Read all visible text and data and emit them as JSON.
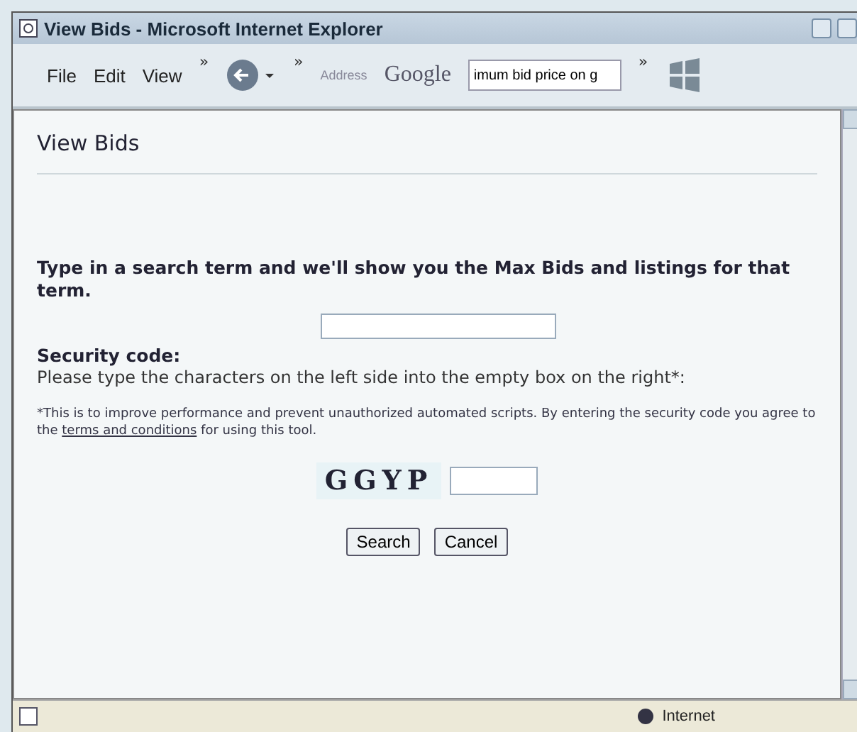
{
  "window": {
    "title": "View Bids - Microsoft Internet Explorer"
  },
  "menu": [
    "File",
    "Edit",
    "View"
  ],
  "toolbar": {
    "chevron": "»",
    "address_label": "Address",
    "search_brand": "Google",
    "search_value": "imum bid price on g"
  },
  "page": {
    "heading": "View Bids",
    "prompt": "Type in a search term and we'll show you the Max Bids and listings for that term.",
    "security_label": "Security code:",
    "security_text": "Please type the characters on the left side into the empty box on the right*:",
    "note": {
      "before": "*This is to improve performance and prevent unauthorized automated scripts. By entering the security code you agree to the ",
      "link": "terms and conditions",
      "after": " for using this tool."
    },
    "captcha": "GGYP",
    "buttons": [
      "Search",
      "Cancel"
    ]
  },
  "status_bar": {
    "zone": "Internet"
  }
}
